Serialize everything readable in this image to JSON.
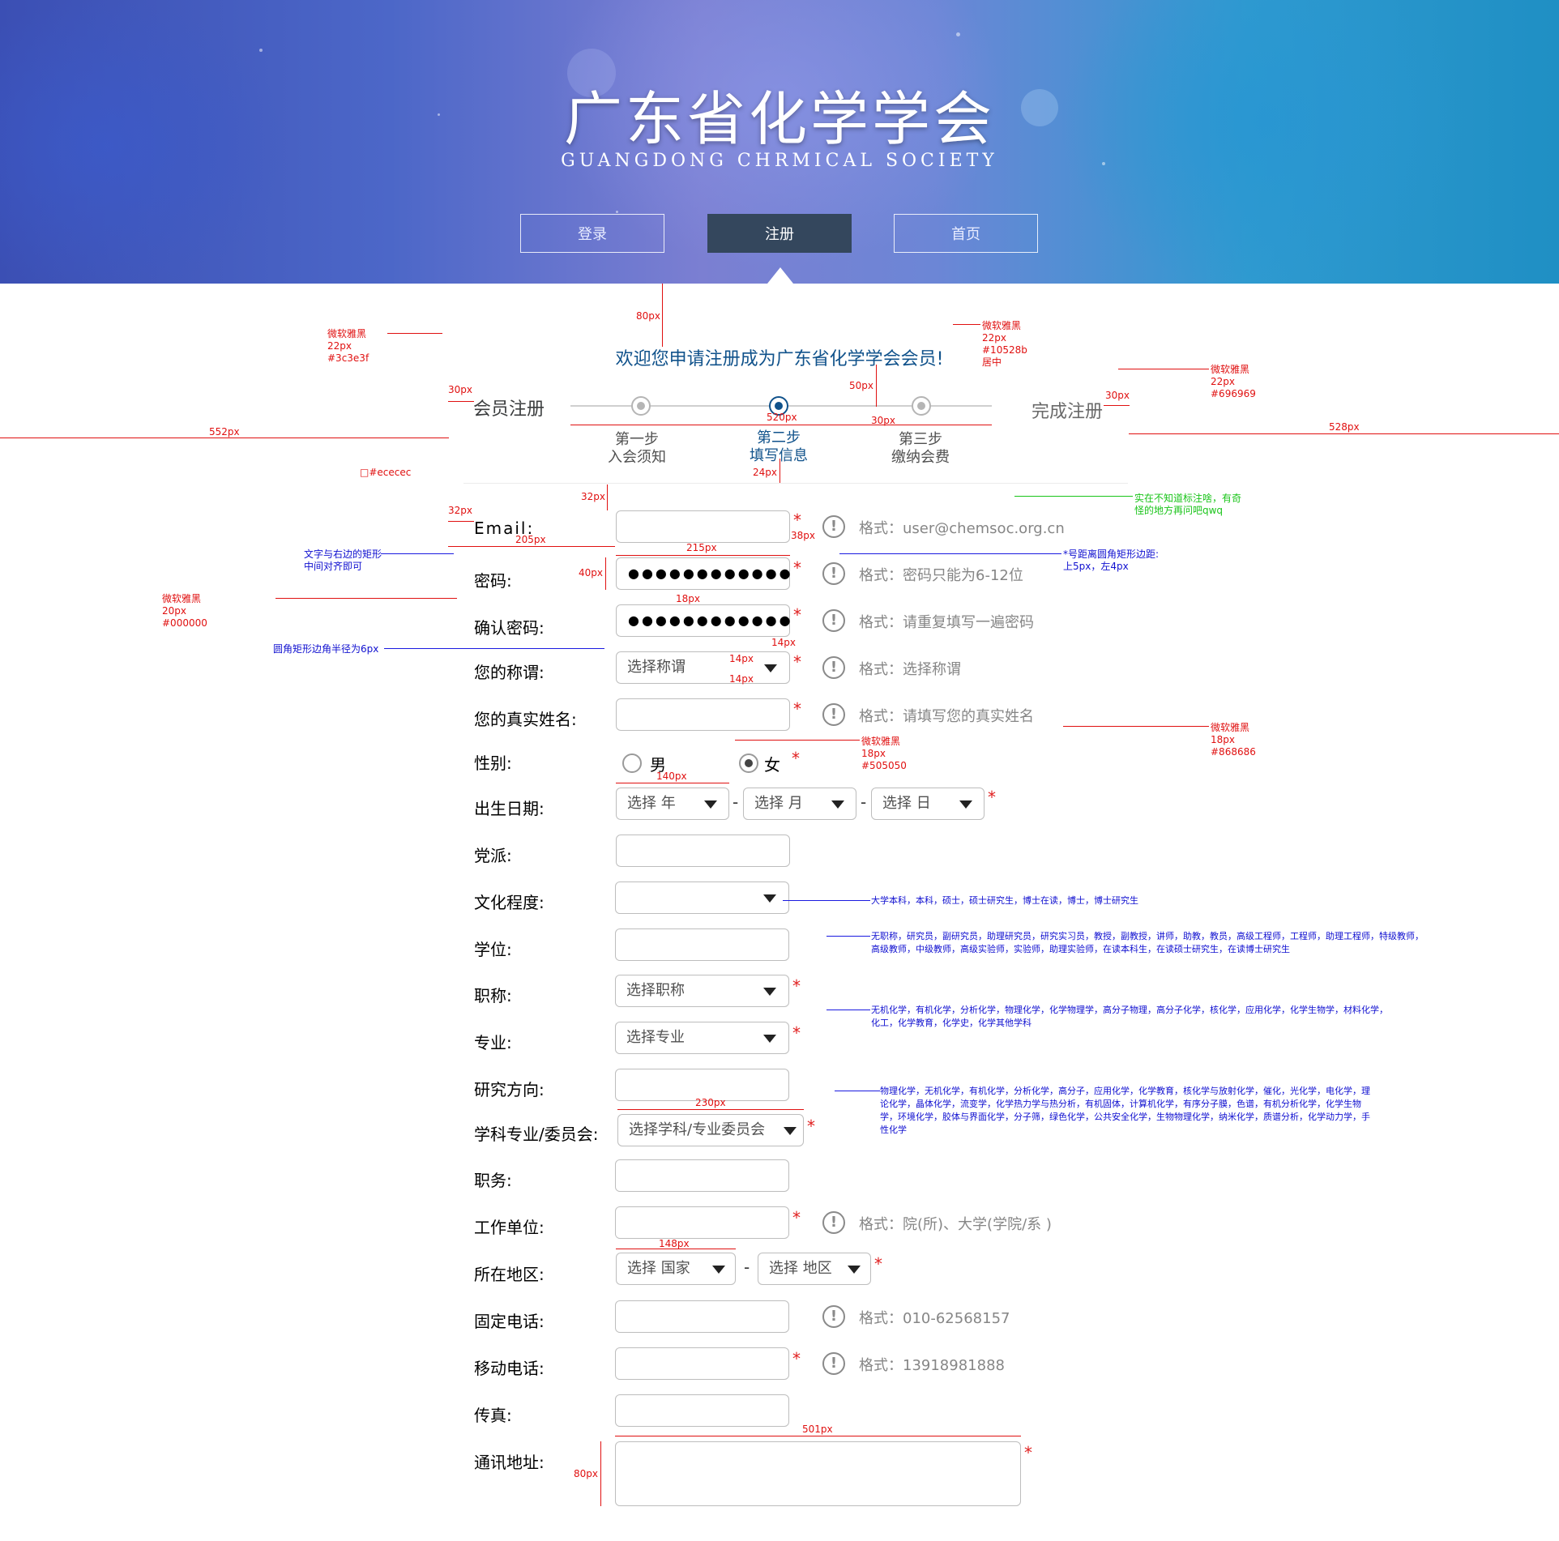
{
  "header": {
    "title": "广东省化学学会",
    "subtitle": "GUANGDONG CHRMICAL SOCIETY",
    "nav": [
      {
        "label": "登录"
      },
      {
        "label": "注册"
      },
      {
        "label": "首页"
      }
    ]
  },
  "welcome": "欢迎您申请注册成为广东省化学学会会员!",
  "steps": {
    "left_label": "会员注册",
    "right_label": "完成注册",
    "items": [
      {
        "title": "第一步",
        "desc": "入会须知"
      },
      {
        "title": "第二步",
        "desc": "填写信息"
      },
      {
        "title": "第三步",
        "desc": "缴纳会费"
      }
    ],
    "active_index": 1
  },
  "form": {
    "email": {
      "label": "Email:",
      "hint": "格式：user@chemsoc.org.cn"
    },
    "password": {
      "label": "密码:",
      "value": "●●●●●●●●●●●●",
      "hint": "格式：密码只能为6-12位"
    },
    "confirm": {
      "label": "确认密码:",
      "value": "●●●●●●●●●●●●",
      "hint": "格式：请重复填写一遍密码"
    },
    "title": {
      "label": "您的称谓:",
      "placeholder": "选择称谓",
      "hint": "格式：选择称谓"
    },
    "realname": {
      "label": "您的真实姓名:",
      "hint": "格式：请填写您的真实姓名"
    },
    "gender": {
      "label": "性别:",
      "male": "男",
      "female": "女",
      "selected": "女"
    },
    "birth": {
      "label": "出生日期:",
      "year": "选择  年",
      "month": "选择  月",
      "day": "选择  日",
      "sep": "-"
    },
    "party": {
      "label": "党派:"
    },
    "education": {
      "label": "文化程度:"
    },
    "degree": {
      "label": "学位:"
    },
    "jobtitle": {
      "label": "职称:",
      "placeholder": "选择职称"
    },
    "major": {
      "label": "专业:",
      "placeholder": "选择专业"
    },
    "research": {
      "label": "研究方向:"
    },
    "committee": {
      "label": "学科专业/委员会:",
      "placeholder": "选择学科/专业委员会"
    },
    "position": {
      "label": "职务:"
    },
    "workplace": {
      "label": "工作单位:",
      "hint": "格式：院(所)、大学(学院/系 )"
    },
    "region": {
      "label": "所在地区:",
      "country": "选择  国家",
      "area": "选择  地区",
      "sep": "-"
    },
    "phone": {
      "label": "固定电话:",
      "hint": "格式：010-62568157"
    },
    "mobile": {
      "label": "移动电话:",
      "hint": "格式：13918981888"
    },
    "fax": {
      "label": "传真:"
    },
    "address": {
      "label": "通讯地址:"
    },
    "required_mark": "*",
    "hint_icon": "!"
  },
  "annotations": {
    "a_80": "80px",
    "a_welcome_spec": [
      "微软雅黑",
      "22px",
      "#10528b",
      "居中"
    ],
    "a_left_spec": [
      "微软雅黑",
      "22px",
      "#3c3e3f"
    ],
    "a_right_spec": [
      "微软雅黑",
      "22px",
      "#696969"
    ],
    "a_30l": "30px",
    "a_30r": "30px",
    "a_50": "50px",
    "a_552": "552px",
    "a_528": "528px",
    "a_520": "520px",
    "a_30c": "30px",
    "a_24": "24px",
    "a_green": [
      "实在不知道标注啥，有奇",
      "怪的地方再问吧qwq"
    ],
    "a_ecec": "□#ececec",
    "a_32a": "32px",
    "a_32b": "32px",
    "a_205": "205px",
    "a_215": "215px",
    "a_38": "38px",
    "a_40": "40px",
    "a_18": "18px",
    "a_align": [
      "文字与右边的矩形",
      "中间对齐即可"
    ],
    "a_star": [
      "*号距离圆角矩形边距:",
      "上5px，左4px"
    ],
    "a_label_spec": [
      "微软雅黑",
      "20px",
      "#000000"
    ],
    "a_radius": "圆角矩形边角半径为6px",
    "a_14a": "14px",
    "a_14b": "14px",
    "a_14c": "14px",
    "a_ph_spec": [
      "微软雅黑",
      "18px",
      "#505050"
    ],
    "a_hint_spec": [
      "微软雅黑",
      "18px",
      "#868686"
    ],
    "a_140": "140px",
    "a_230": "230px",
    "a_148": "148px",
    "a_501": "501px",
    "a_80b": "80px",
    "edu_options": "大学本科，本科，硕士，硕士研究生，博士在读，博士，博士研究生",
    "title_options": "无职称，研究员，副研究员，助理研究员，研究实习员，教授，副教授，讲师，助教，教员，高级工程师，工程师，助理工程师，特级教师，高级教师，中级教师，高级实验师，实验师，助理实验师，在读本科生，在读硕士研究生，在读博士研究生",
    "major_options": "无机化学，有机化学，分析化学，物理化学，化学物理学，高分子物理，高分子化学，核化学，应用化学，化学生物学，材料化学，化工，化学教育，化学史，化学其他学科",
    "committee_options": "物理化学，无机化学，有机化学，分析化学，高分子，应用化学，化学教育，核化学与放射化学，催化，光化学，电化学，理论化学，晶体化学，流变学，化学热力学与热分析，有机固体，计算机化学，有序分子膜，色谱，有机分析化学，化学生物学，环境化学，胶体与界面化学，分子筛，绿色化学，公共安全化学，生物物理化学，纳米化学，质谱分析，化学动力学，手性化学"
  }
}
